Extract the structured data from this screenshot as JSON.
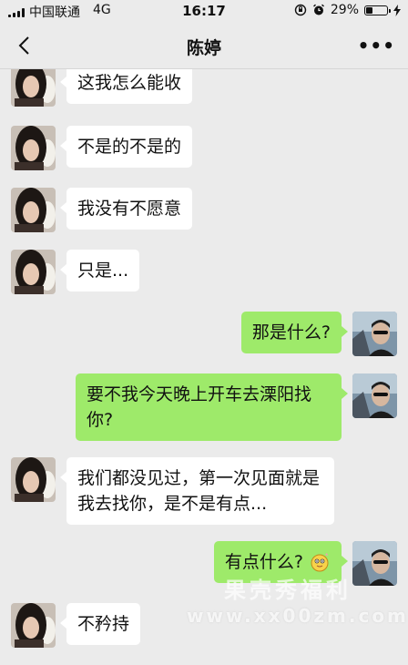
{
  "status_bar": {
    "carrier": "中国联通",
    "network": "4G",
    "time": "16:17",
    "battery_percent": "29%",
    "battery_level": 0.29
  },
  "nav": {
    "title": "陈婷",
    "back_icon": "chevron-left-icon",
    "more_icon": "more-dots-icon",
    "more_label": "•••"
  },
  "messages": [
    {
      "side": "left",
      "text": "这我怎么能收"
    },
    {
      "side": "left",
      "text": "不是的不是的"
    },
    {
      "side": "left",
      "text": "我没有不愿意"
    },
    {
      "side": "left",
      "text": "只是..."
    },
    {
      "side": "right",
      "text": "那是什么?"
    },
    {
      "side": "right",
      "text": "要不我今天晚上开车去溧阳找你?"
    },
    {
      "side": "left",
      "text": "我们都没见过，第一次见面就是我去找你，是不是有点..."
    },
    {
      "side": "right",
      "text": "有点什么?",
      "emoji": "cute-emoji-icon"
    },
    {
      "side": "left",
      "text": "不矜持"
    }
  ],
  "watermark": {
    "chinese": "果壳秀福利",
    "url": "www.xx00zm.com"
  },
  "colors": {
    "background": "#ebebeb",
    "bubble_self": "#9eea6a",
    "bubble_other": "#ffffff"
  }
}
